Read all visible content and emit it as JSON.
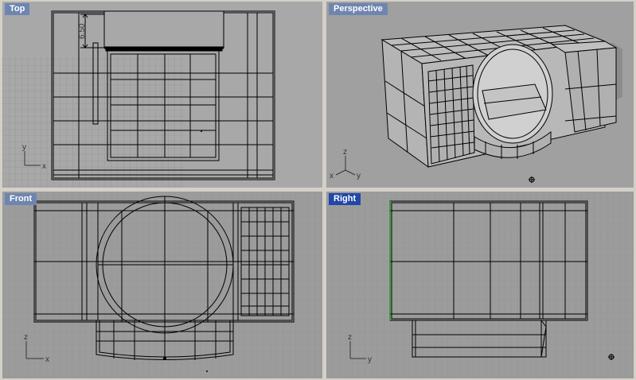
{
  "viewports": {
    "top": {
      "title": "Top",
      "dimension": "6.50",
      "axis_x": "x",
      "axis_y": "y"
    },
    "perspective": {
      "title": "Perspective",
      "axis_x": "x",
      "axis_y": "y",
      "axis_z": "z"
    },
    "front": {
      "title": "Front",
      "axis_x": "x",
      "axis_z": "z"
    },
    "right": {
      "title": "Right",
      "axis_y": "y",
      "axis_z": "z"
    }
  },
  "active_viewport": "right",
  "colors": {
    "viewport_bg": "#9c9c9c",
    "grid_minor": "#8f8f8f",
    "grid_major": "#828282",
    "wire": "#000000",
    "title_inactive": "#6e85b0",
    "title_active": "#2148a8",
    "frame": "#d4d0c8"
  }
}
